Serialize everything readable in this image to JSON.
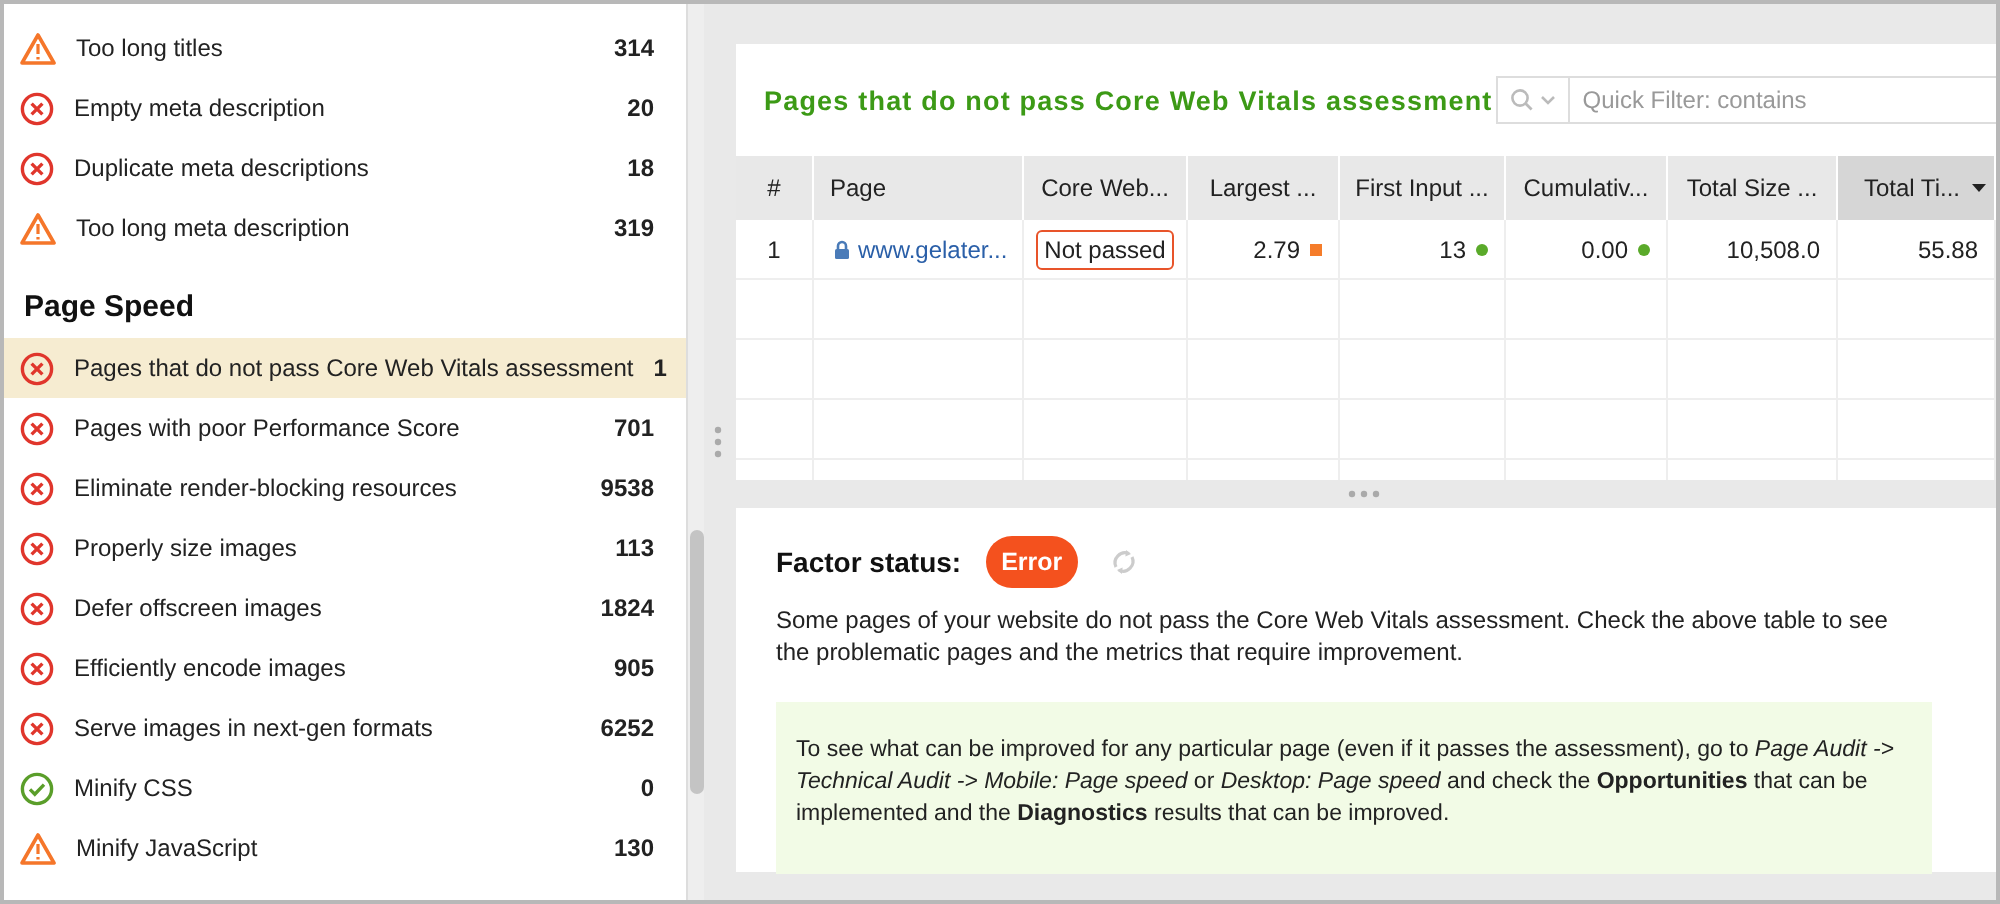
{
  "sidebar": {
    "items": [
      {
        "kind": "warning",
        "label": "Too long titles",
        "count": "314",
        "selected": false
      },
      {
        "kind": "error",
        "label": "Empty meta description",
        "count": "20",
        "selected": false
      },
      {
        "kind": "error",
        "label": "Duplicate meta descriptions",
        "count": "18",
        "selected": false
      },
      {
        "kind": "warning",
        "label": "Too long meta description",
        "count": "319",
        "selected": false
      }
    ],
    "section": {
      "title": "Page Speed",
      "items": [
        {
          "kind": "error",
          "label": "Pages that do not pass Core Web Vitals assessment",
          "count": "1",
          "selected": true
        },
        {
          "kind": "error",
          "label": "Pages with poor Performance Score",
          "count": "701",
          "selected": false
        },
        {
          "kind": "error",
          "label": "Eliminate render-blocking resources",
          "count": "9538",
          "selected": false
        },
        {
          "kind": "error",
          "label": "Properly size images",
          "count": "113",
          "selected": false
        },
        {
          "kind": "error",
          "label": "Defer offscreen images",
          "count": "1824",
          "selected": false
        },
        {
          "kind": "error",
          "label": "Efficiently encode images",
          "count": "905",
          "selected": false
        },
        {
          "kind": "error",
          "label": "Serve images in next-gen formats",
          "count": "6252",
          "selected": false
        },
        {
          "kind": "ok",
          "label": "Minify CSS",
          "count": "0",
          "selected": false
        },
        {
          "kind": "warning",
          "label": "Minify JavaScript",
          "count": "130",
          "selected": false
        }
      ]
    }
  },
  "report": {
    "title": "Pages that do not pass Core Web Vitals assessment",
    "search": {
      "placeholder": "Quick Filter: contains"
    },
    "table": {
      "columns": [
        {
          "label": "#",
          "sorted": false
        },
        {
          "label": "Page",
          "sorted": false
        },
        {
          "label": "Core Web...",
          "sorted": false
        },
        {
          "label": "Largest ...",
          "sorted": false
        },
        {
          "label": "First Input ...",
          "sorted": false
        },
        {
          "label": "Cumulativ...",
          "sorted": false
        },
        {
          "label": "Total Size ...",
          "sorted": false
        },
        {
          "label": "Total Ti...",
          "sorted": true
        }
      ],
      "rows": [
        [
          {
            "kind": "number",
            "text": "1"
          },
          {
            "kind": "link",
            "text": "www.gelater..."
          },
          {
            "kind": "badge",
            "text": "Not passed"
          },
          {
            "kind": "square",
            "text": "2.79",
            "color": "#f57c2a"
          },
          {
            "kind": "dot",
            "text": "13",
            "color": "#5aaa2a"
          },
          {
            "kind": "dot",
            "text": "0.00",
            "color": "#5aaa2a"
          },
          {
            "kind": "number",
            "text": "10,508.0"
          },
          {
            "kind": "number",
            "text": "55.88"
          }
        ]
      ]
    }
  },
  "factor": {
    "label": "Factor status:",
    "status": "Error",
    "description": "Some pages of your website do not pass the Core Web Vitals assessment. Check the above table to see the problematic pages and the metrics that require improvement.",
    "tip": "To see what can be improved for any particular page (even if it passes the assessment), go to *Page Audit -> Technical Audit -> Mobile: Page speed* or *Desktop: Page speed* and check the **Opportunities** that can be implemented and the **Diagnostics** results that can be improved."
  }
}
